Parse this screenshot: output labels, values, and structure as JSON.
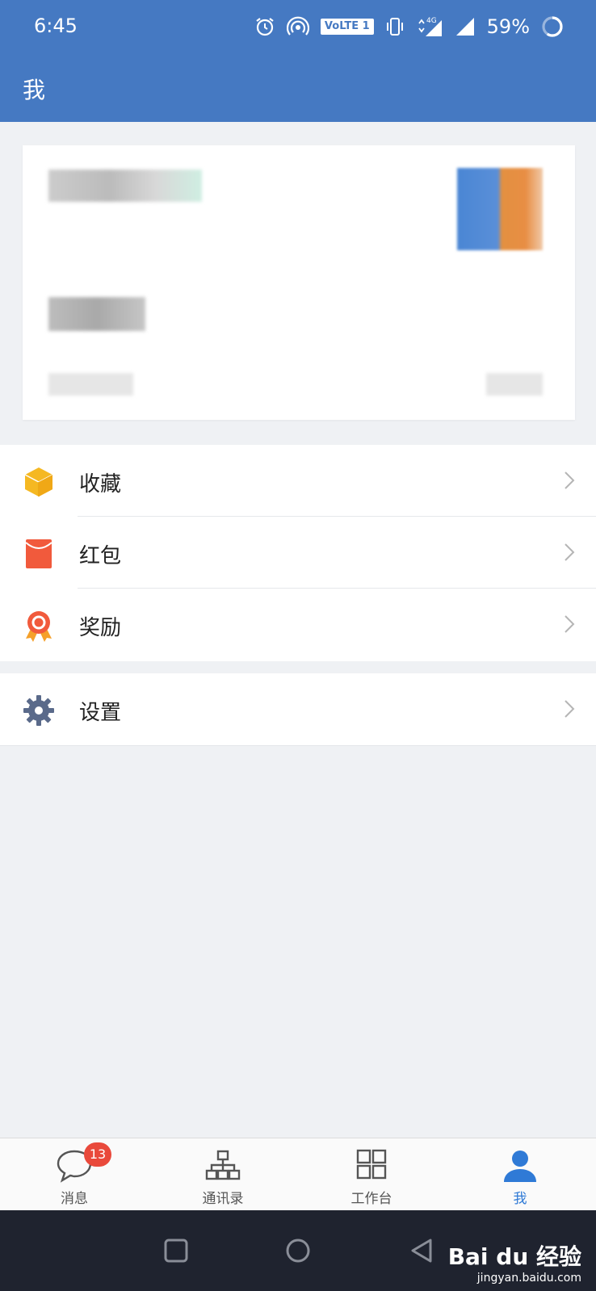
{
  "status_bar": {
    "time": "6:45",
    "volte": "VoLTE 1",
    "network": "4G",
    "battery": "59%"
  },
  "app_bar": {
    "title": "我"
  },
  "menu": [
    {
      "label": "收藏",
      "icon": "box-icon",
      "color": "#f5b822"
    },
    {
      "label": "红包",
      "icon": "red-envelope-icon",
      "color": "#f15a3c"
    },
    {
      "label": "奖励",
      "icon": "award-medal-icon",
      "color": "#f15a3c"
    }
  ],
  "settings": {
    "label": "设置",
    "icon": "gear-icon",
    "color": "#5a6a8a"
  },
  "tab_bar": {
    "tabs": [
      {
        "label": "消息",
        "icon": "chat-bubble-icon",
        "badge": "13"
      },
      {
        "label": "通讯录",
        "icon": "org-chart-icon"
      },
      {
        "label": "工作台",
        "icon": "grid-icon"
      },
      {
        "label": "我",
        "icon": "person-icon",
        "active": true
      }
    ],
    "accent": "#2f7ad6"
  },
  "watermark": {
    "brand": "Bai du 经验",
    "url": "jingyan.baidu.com"
  },
  "colors": {
    "primary": "#4579c2",
    "background": "#eff1f4",
    "nav_bar": "#1f232f"
  }
}
